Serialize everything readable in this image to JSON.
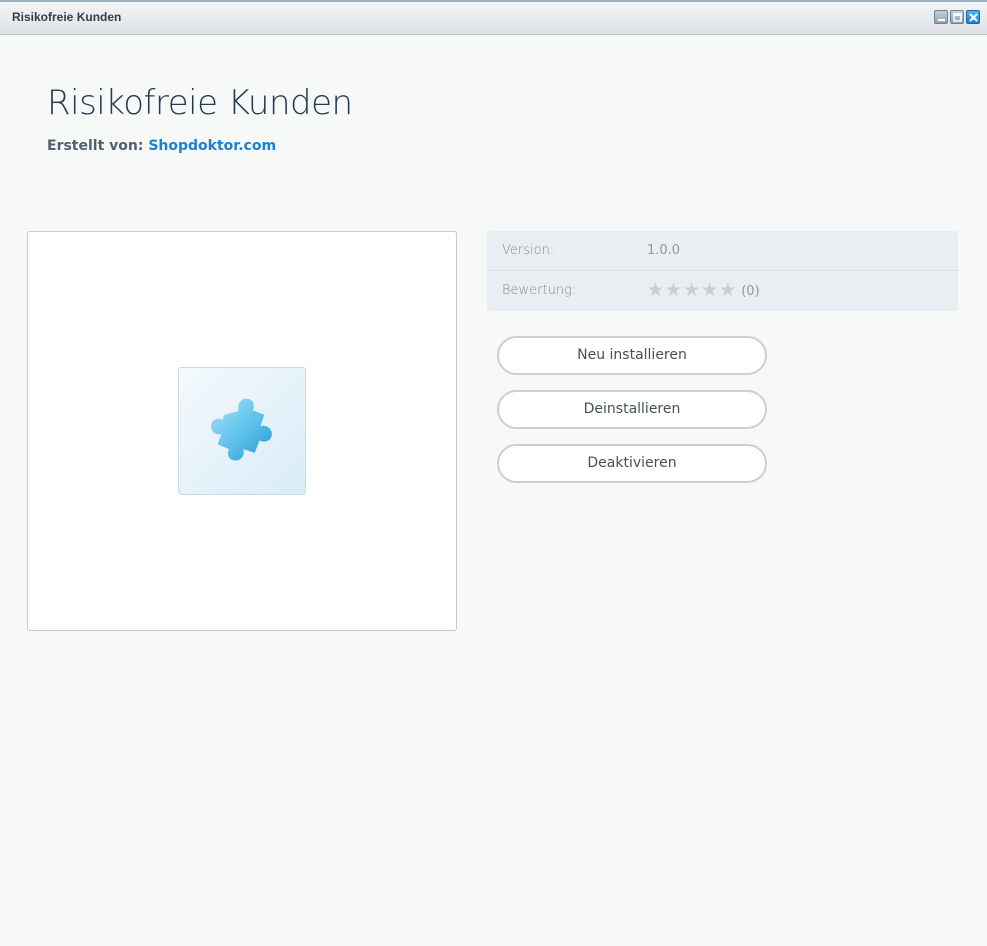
{
  "window": {
    "title": "Risikofreie Kunden",
    "controls": [
      "minimize-icon",
      "maximize-icon",
      "close-icon"
    ]
  },
  "plugin": {
    "name": "Risikofreie Kunden",
    "author_label": "Erstellt von:",
    "author_name": "Shopdoktor.com",
    "icon": "puzzle-piece-icon"
  },
  "info": {
    "version_label": "Version:",
    "version_value": "1.0.0",
    "rating_label": "Bewertung:",
    "rating_stars": 0,
    "rating_max": 5,
    "rating_count": "(0)"
  },
  "actions": {
    "reinstall_label": "Neu installieren",
    "uninstall_label": "Deinstallieren",
    "deactivate_label": "Deaktivieren"
  },
  "colors": {
    "accent": "#1a82d0",
    "title_text": "#22394f",
    "star_empty": "#c5cfd8",
    "puzzle_light": "#8ad8f2",
    "puzzle_dark": "#2796d6"
  }
}
